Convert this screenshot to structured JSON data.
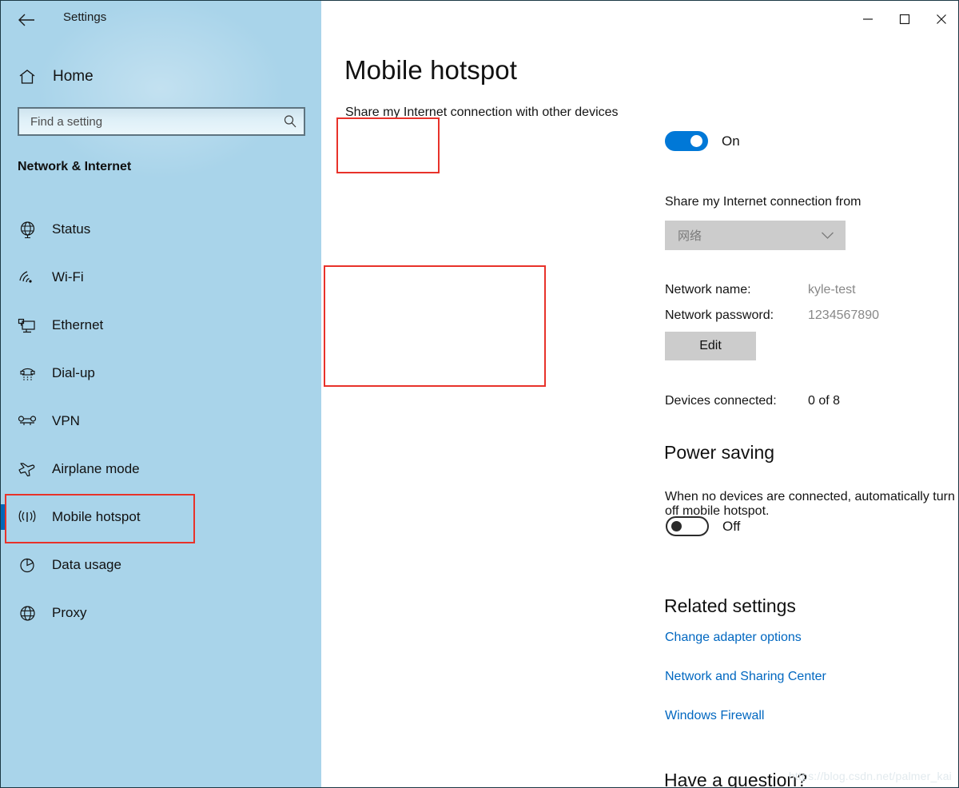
{
  "window": {
    "title": "Settings",
    "back_icon": "back-arrow-icon",
    "controls": [
      {
        "name": "minimize-button",
        "glyph": "minimize-icon"
      },
      {
        "name": "maximize-button",
        "glyph": "maximize-icon"
      },
      {
        "name": "close-button",
        "glyph": "close-icon"
      }
    ]
  },
  "sidebar": {
    "home_label": "Home",
    "home_icon": "home-icon",
    "search": {
      "placeholder": "Find a setting",
      "value": "",
      "icon": "search-icon"
    },
    "category_heading": "Network & Internet",
    "items": [
      {
        "label": "Status",
        "icon": "globe-icon",
        "selected": false
      },
      {
        "label": "Wi-Fi",
        "icon": "wifi-icon",
        "selected": false
      },
      {
        "label": "Ethernet",
        "icon": "ethernet-icon",
        "selected": false
      },
      {
        "label": "Dial-up",
        "icon": "dialup-phone-icon",
        "selected": false
      },
      {
        "label": "VPN",
        "icon": "vpn-icon",
        "selected": false
      },
      {
        "label": "Airplane mode",
        "icon": "airplane-icon",
        "selected": false
      },
      {
        "label": "Mobile hotspot",
        "icon": "hotspot-icon",
        "selected": true
      },
      {
        "label": "Data usage",
        "icon": "pie-chart-icon",
        "selected": false
      },
      {
        "label": "Proxy",
        "icon": "globe-icon",
        "selected": false
      }
    ]
  },
  "main": {
    "page_title": "Mobile hotspot",
    "share_devices_label": "Share my Internet connection with other devices",
    "share_toggle": {
      "state": "On",
      "on": true
    },
    "share_from_label": "Share my Internet connection from",
    "source_dropdown": {
      "value": "网络",
      "chevron": "chevron-down-icon",
      "disabled": true
    },
    "network_info": {
      "name_label": "Network name:",
      "name_value": "kyle-test",
      "password_label": "Network password:",
      "password_value": "1234567890",
      "edit_button": "Edit"
    },
    "devices": {
      "label": "Devices connected:",
      "value": "0 of 8"
    },
    "power_saving": {
      "heading": "Power saving",
      "description": "When no devices are connected, automatically turn off mobile hotspot.",
      "toggle": {
        "state": "Off",
        "on": false
      }
    },
    "related_settings": {
      "heading": "Related settings",
      "links": [
        "Change adapter options",
        "Network and Sharing Center",
        "Windows Firewall"
      ]
    },
    "question_heading": "Have a question?"
  },
  "watermark": "https://blog.csdn.net/palmer_kai",
  "colors": {
    "sidebar_bg": "#a9d4ea",
    "accent_blue": "#0078d7",
    "link_blue": "#0067c0",
    "annotation_red": "#e8322a",
    "disabled_gray": "#cccccc"
  }
}
